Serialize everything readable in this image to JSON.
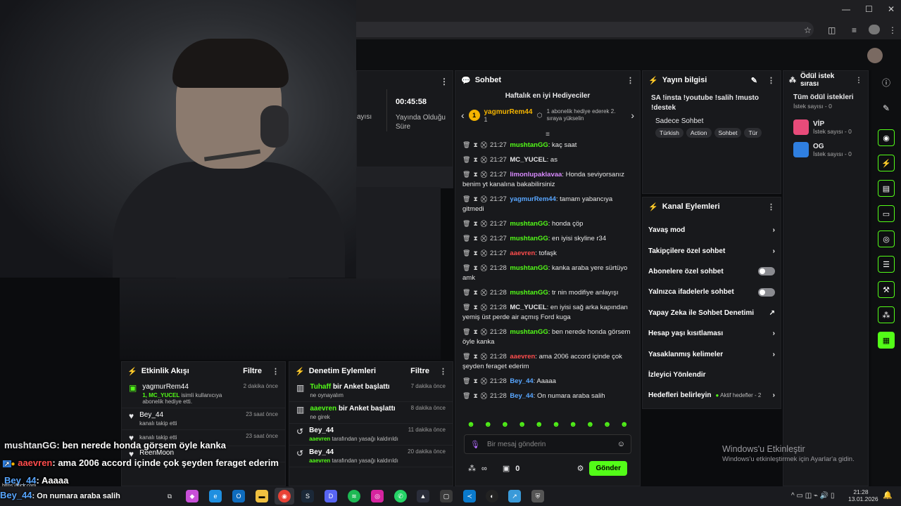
{
  "browser": {
    "window_controls": [
      "—",
      "☐",
      "✕"
    ],
    "toolbar_icons": [
      "star-icon",
      "extensions-icon",
      "media-icon",
      "profile-icon",
      "menu-icon"
    ]
  },
  "stream_stats": {
    "duration": "00:45:58",
    "duration_label": "Yayında Olduğu Süre",
    "partial_label": "ayısı"
  },
  "chat": {
    "title": "Sohbet",
    "gifters_title": "Haftalık en iyi Hediyeciler",
    "top_gifter": {
      "rank": "1",
      "name": "yagmurRem44",
      "count": "1",
      "note": "1 abonelik hediye ederek 2. sıraya yükselin"
    },
    "messages": [
      {
        "time": "21:27",
        "user": "mushtanGG",
        "color": "#53fc18",
        "text": "kaç saat"
      },
      {
        "time": "21:27",
        "user": "MC_YUCEL",
        "color": "#e8e8ea",
        "text": "as"
      },
      {
        "time": "21:27",
        "user": "limonlupaklavaa",
        "color": "#d98aff",
        "text": "Honda seviyorsanız benim yt kanalına bakabilirsiniz"
      },
      {
        "time": "21:27",
        "user": "yagmurRem44",
        "color": "#58a6ff",
        "text": "tamam yabancıya gitmedi"
      },
      {
        "time": "21:27",
        "user": "mushtanGG",
        "color": "#53fc18",
        "text": "honda çöp"
      },
      {
        "time": "21:27",
        "user": "mushtanGG",
        "color": "#53fc18",
        "text": "en iyisi skyline r34"
      },
      {
        "time": "21:27",
        "user": "aaevren",
        "color": "#ff4d4d",
        "text": "tofaşk"
      },
      {
        "time": "21:28",
        "user": "mushtanGG",
        "color": "#53fc18",
        "text": "kanka araba yere sürtüyo amk"
      },
      {
        "time": "21:28",
        "user": "mushtanGG",
        "color": "#53fc18",
        "text": "tr nin modifiye anlayışı"
      },
      {
        "time": "21:28",
        "user": "MC_YUCEL",
        "color": "#e8e8ea",
        "text": "en iyisi sağ arka kapından yemiş üst perde air açmış Ford kuga"
      },
      {
        "time": "21:28",
        "user": "mushtanGG",
        "color": "#53fc18",
        "text": "ben nerede honda görsem öyle kanka"
      },
      {
        "time": "21:28",
        "user": "aaevren",
        "color": "#ff4d4d",
        "text": "ama 2006 accord içinde çok şeyden feraget ederim"
      },
      {
        "time": "21:28",
        "user": "Bey_44",
        "color": "#58a6ff",
        "text": "Aaaaa"
      },
      {
        "time": "21:28",
        "user": "Bey_44",
        "color": "#58a6ff",
        "text": "On numara araba salih"
      }
    ],
    "input_placeholder": "Bir mesaj gönderin",
    "points": "0",
    "send_label": "Gönder",
    "infinity": "∞"
  },
  "stream_info": {
    "title": "Yayın bilgisi",
    "stream_title": "SA !insta !youtube !salih !musto !destek",
    "category": "Sadece Sohbet",
    "tags": [
      "Türkish",
      "Action",
      "Sohbet",
      "Tür"
    ]
  },
  "channel_actions": {
    "title": "Kanal Eylemleri",
    "items": [
      "Yavaş mod",
      "Takipçilere özel sohbet",
      "Abonelere özel sohbet",
      "Yalnızca ifadelerle sohbet",
      "Yapay Zeka ile Sohbet Denetimi",
      "Hesap yaşı kısıtlaması",
      "Yasaklanmış kelimeler",
      "İzleyici Yönlendir",
      "Hedefleri belirleyin"
    ],
    "goals_note": "Aktif hedefler - 2"
  },
  "rewards": {
    "title": "Ödül istek sırası",
    "all_label": "Tüm ödül istekleri",
    "all_count": "İstek sayısı - 0",
    "items": [
      {
        "name": "VİP",
        "count": "İstek sayısı - 0",
        "color": "#e84b7a"
      },
      {
        "name": "OG",
        "count": "İstek sayısı - 0",
        "color": "#2f7fe0"
      }
    ]
  },
  "activity": {
    "title": "Etkinlik Akışı",
    "filter": "Filtre",
    "items": [
      {
        "name": "yagmurRem44",
        "time": "2 dakika önce",
        "sub_user": "1, MC_YUCEL",
        "sub": "isimli kullanıcıya abonelik hediye etti."
      },
      {
        "name": "Bey_44",
        "time": "23 saat önce",
        "sub": "kanalı takip etti"
      },
      {
        "name": "",
        "time": "23 saat önce",
        "sub": "kanalı takip etti"
      },
      {
        "name": "ReenMoon",
        "time": "",
        "sub": ""
      }
    ]
  },
  "moderation": {
    "title": "Denetim Eylemleri",
    "filter": "Filtre",
    "items": [
      {
        "user": "Tuhaff",
        "action": "bir Anket başlattı",
        "sub": "ne oynayalım",
        "time": "7 dakika önce"
      },
      {
        "user": "aaevren",
        "action": "bir Anket başlattı",
        "sub": "ne girek",
        "time": "8 dakika önce"
      },
      {
        "user": "Bey_44",
        "action": "",
        "sub_user": "aaevren",
        "sub": "tarafından yasağı kaldırıldı",
        "time": "11 dakika önce"
      },
      {
        "user": "Bey_44",
        "action": "",
        "sub_user": "aaevren",
        "sub": "tarafından yasağı kaldırıldı",
        "time": "20 dakika önce"
      }
    ]
  },
  "overlay": {
    "lines": [
      {
        "user": "mushtanGG",
        "color": "#e8e8ea",
        "text": ": ben nerede honda görsem öyle kanka"
      },
      {
        "user": "aaevren",
        "color": "#ff4d4d",
        "text": ": ama 2006 accord içinde çok şeyden feraget ederim"
      },
      {
        "user": "Bey_44",
        "color": "#58a6ff",
        "text": ": Aaaaa"
      },
      {
        "user": "Bey_44",
        "color": "#58a6ff",
        "text": ": On numara araba salih"
      }
    ],
    "url": "https://kick.com"
  },
  "windows": {
    "activate_title": "Windows'u Etkinleştir",
    "activate_sub": "Windows'u etkinleştirmek için Ayarlar'a gidin.",
    "time": "21:28",
    "date": "13.01.2026"
  }
}
